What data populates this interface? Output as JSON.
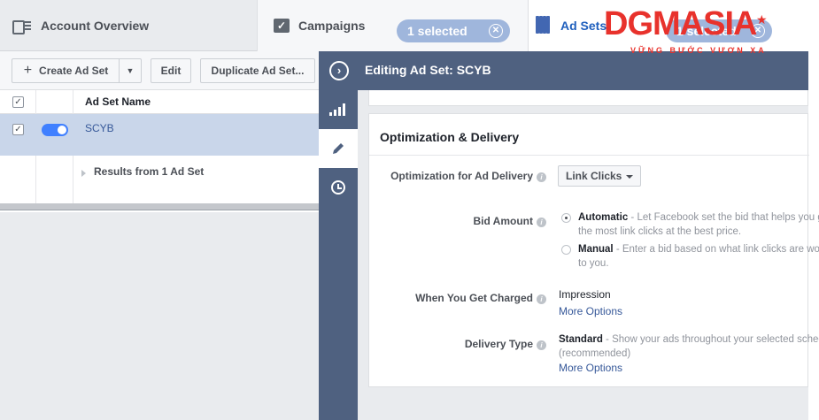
{
  "nav": {
    "account_overview": "Account Overview",
    "campaigns": "Campaigns",
    "campaigns_selected": "1 selected",
    "adsets": "Ad Sets",
    "adsets_selected": "1 selected"
  },
  "toolbar": {
    "create": "Create Ad Set",
    "edit": "Edit",
    "duplicate": "Duplicate Ad Set..."
  },
  "table": {
    "column_name": "Ad Set Name",
    "row_name": "SCYB",
    "results": "Results from 1 Ad Set"
  },
  "editor": {
    "title": "Editing Ad Set: SCYB",
    "section_title": "Optimization & Delivery",
    "optimization_label": "Optimization for Ad Delivery",
    "optimization_value": "Link Clicks",
    "bid_label": "Bid Amount",
    "bid_automatic_title": "Automatic",
    "bid_automatic_desc": " - Let Facebook set the bid that helps you get the most link clicks at the best price.",
    "bid_manual_title": "Manual",
    "bid_manual_desc": " - Enter a bid based on what link clicks are worth to you.",
    "charged_label": "When You Get Charged",
    "charged_value": "Impression",
    "more_options_1": "More Options",
    "delivery_label": "Delivery Type",
    "delivery_title": "Standard",
    "delivery_desc": " - Show your ads throughout your selected schedule",
    "delivery_note": "(recommended)",
    "more_options_2": "More Options"
  },
  "watermark": {
    "logo": "DGMASIA",
    "tagline": "VỮNG BƯỚC VƯƠN XA"
  },
  "colors": {
    "header_bg": "#4f6180",
    "selected_row": "#c9d6ea",
    "link": "#365899",
    "toggle": "#4080ff",
    "watermark": "#e8322c"
  }
}
